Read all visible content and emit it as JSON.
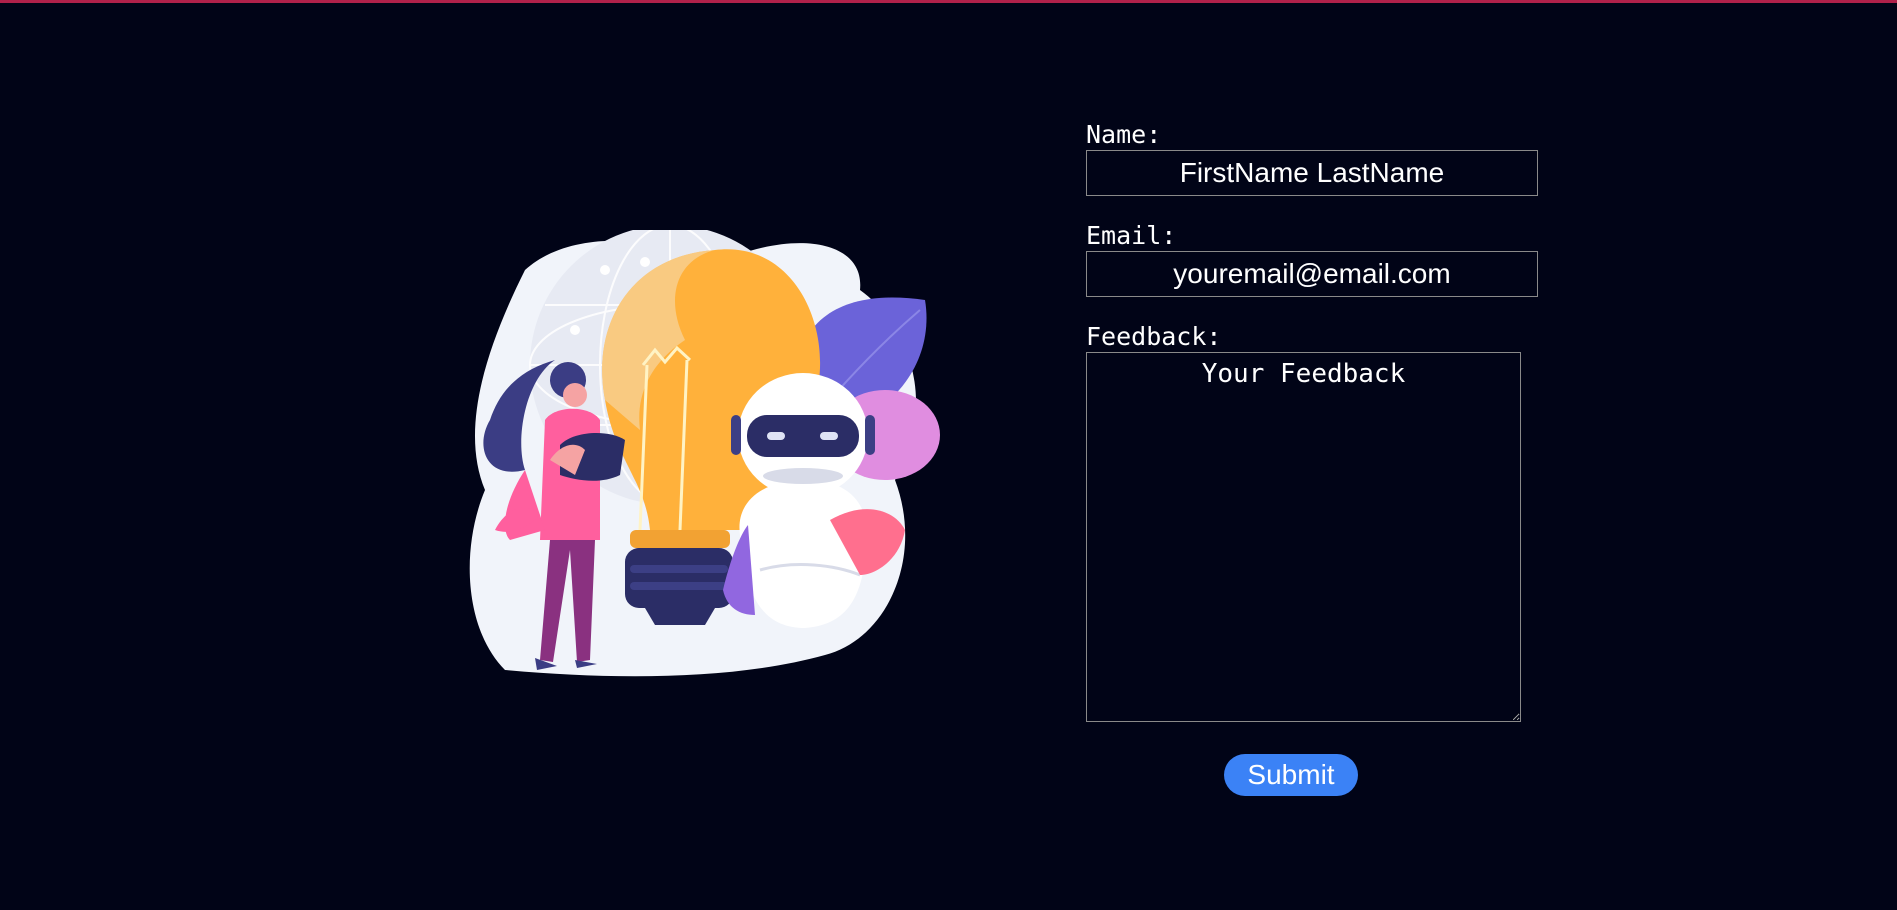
{
  "form": {
    "name_label": "Name:",
    "name_placeholder": "FirstName LastName",
    "email_label": "Email:",
    "email_placeholder": "youremail@email.com",
    "feedback_label": "Feedback:",
    "feedback_placeholder": "Your Feedback",
    "submit_label": "Submit"
  },
  "colors": {
    "background": "#010417",
    "top_bar": "#b0214a",
    "submit_button": "#3b82f6",
    "text": "#ffffff"
  },
  "illustration": {
    "description_icon": "idea-robot-illustration"
  }
}
